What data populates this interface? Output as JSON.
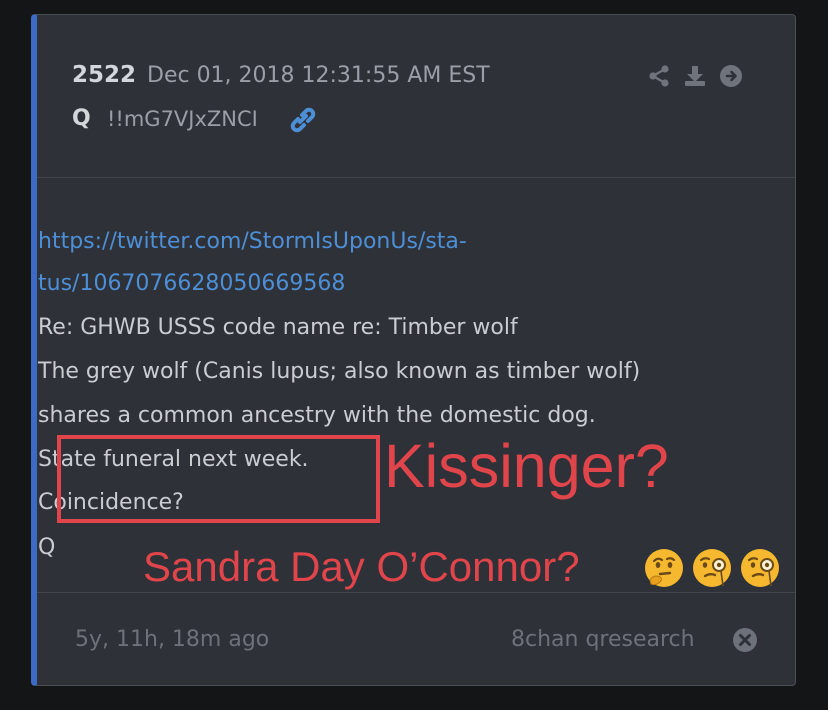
{
  "post": {
    "number": "2522",
    "date": "Dec 01, 2018 12:31:55 AM EST",
    "author": "Q",
    "tripcode": "!!mG7VJxZNCI",
    "icons": [
      "share-icon",
      "download-icon",
      "arrow-right-circle-icon",
      "link-icon"
    ]
  },
  "body": {
    "link_line1": "https://twitter.com/StormIsUponUs/sta-",
    "link_line2": "tus/1067076628050669568",
    "line3": "Re: GHWB USSS code name re: Timber wolf",
    "line4": "The grey wolf (Canis lupus; also known as timber wolf)",
    "line5": "shares a common ancestry with the domestic dog.",
    "line6": "State funeral next week.",
    "line7": "Coincidence?",
    "line8": "Q"
  },
  "footer": {
    "age": "5y, 11h, 18m ago",
    "source": "8chan qresearch",
    "close_icon": "close-circle-icon"
  },
  "annotations": {
    "text1": "Kissinger?",
    "text2": "Sandra Day O’Connor?",
    "emojis": [
      "thinking-face-icon",
      "face-with-monocle-icon",
      "face-with-monocle-icon"
    ],
    "color": "#e0454b"
  },
  "colors": {
    "card_bg": "#2e3137",
    "accent_bar": "#3d69c7",
    "link": "#4d8fd6",
    "text": "#c9ccd1"
  }
}
